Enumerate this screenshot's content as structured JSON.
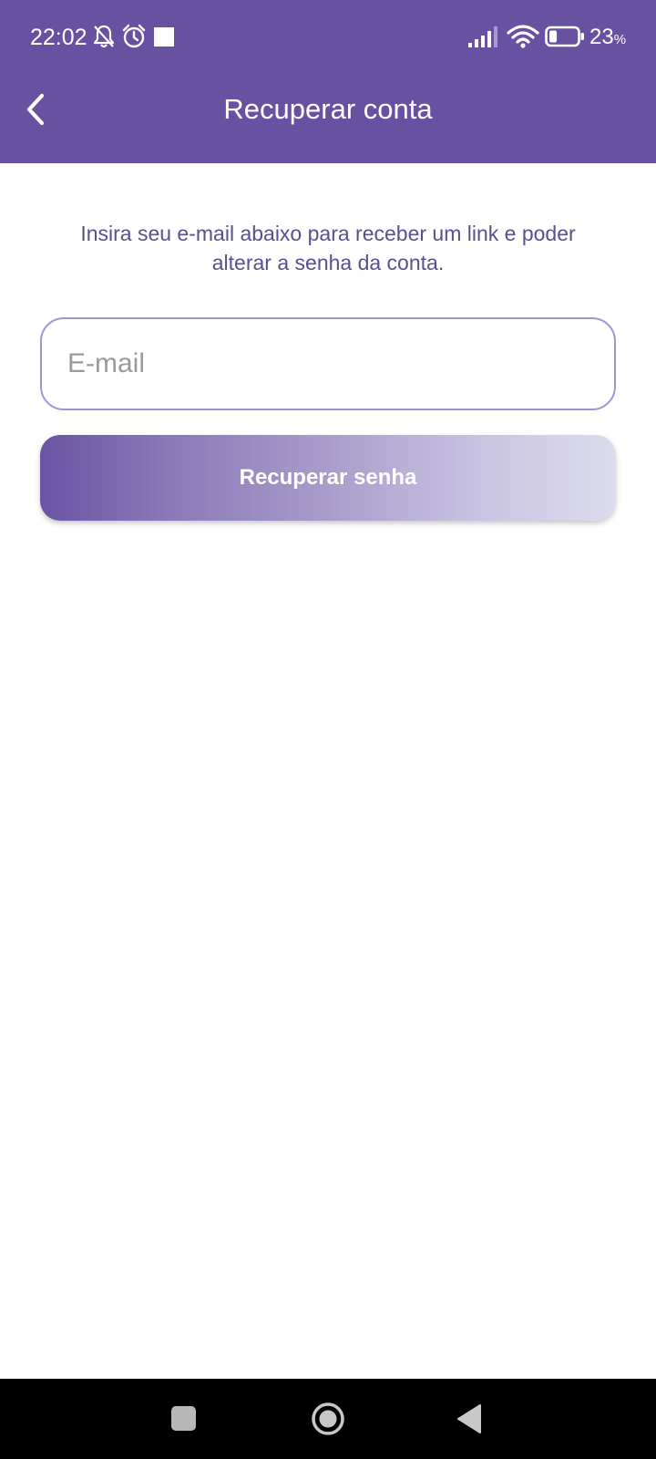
{
  "status_bar": {
    "time": "22:02",
    "battery_level": "23",
    "battery_unit": "%",
    "icons": [
      "bell-off-icon",
      "alarm-icon",
      "notification-square-icon",
      "signal-icon",
      "wifi-icon",
      "battery-icon"
    ]
  },
  "header": {
    "title": "Recuperar conta",
    "back_icon": "chevron-left-icon"
  },
  "content": {
    "instructions": "Insira seu e-mail abaixo para receber um link e poder alterar a senha da conta.",
    "email_placeholder": "E-mail",
    "email_value": "",
    "button_label": "Recuperar senha"
  },
  "nav_bar": {
    "icons": [
      "recents-icon",
      "home-icon",
      "back-triangle-icon"
    ]
  },
  "colors": {
    "primary": "#6851a1",
    "instruction_text": "#5e4c94",
    "field_border": "#a394d6",
    "button_gradient_start": "#6a53a3",
    "button_gradient_end": "#dcdcee"
  }
}
